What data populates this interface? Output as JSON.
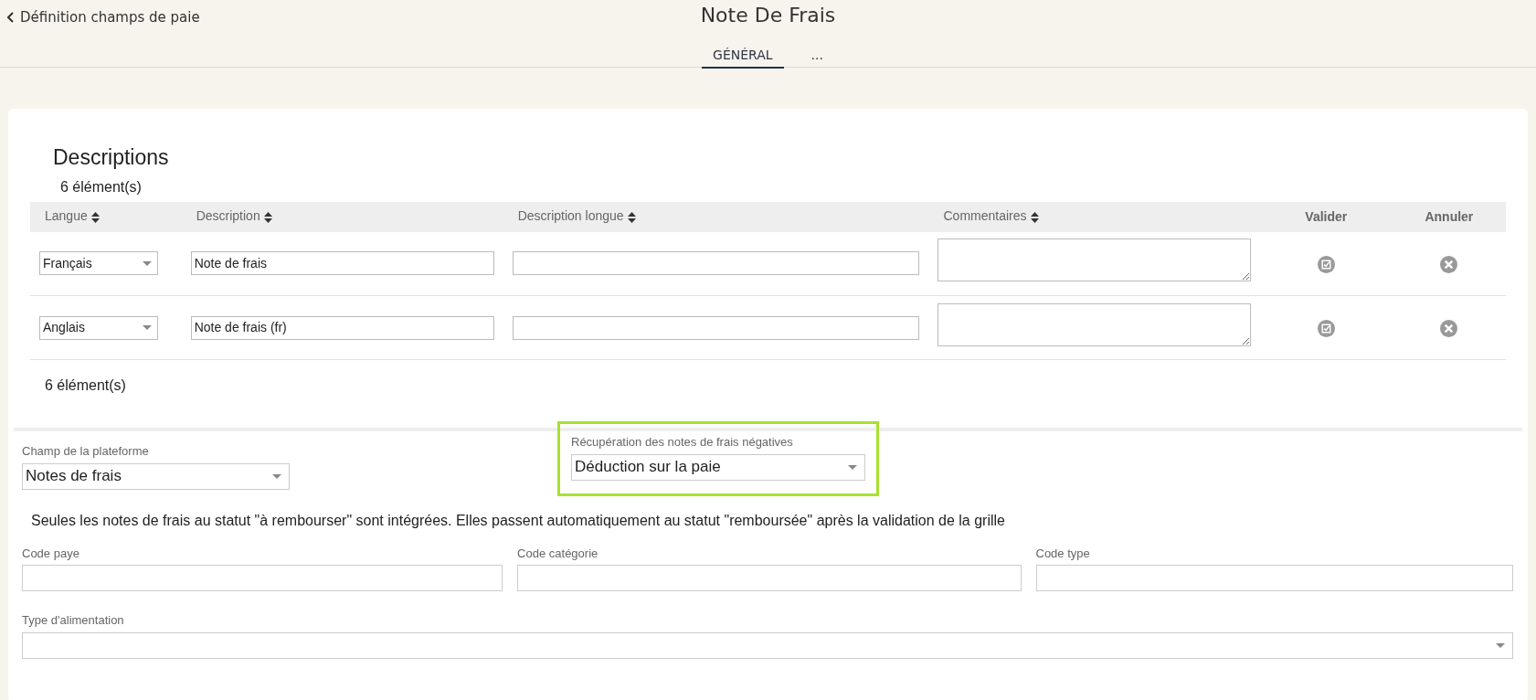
{
  "header": {
    "back_link": "Définition champs de paie",
    "title": "Note De Frais"
  },
  "tabs": [
    {
      "label": "GÉNÉRAL",
      "selected": true
    },
    {
      "label": "...",
      "selected": false
    }
  ],
  "descriptions": {
    "title": "Descriptions",
    "count_top": "6 élément(s)",
    "count_bottom": "6 élément(s)",
    "columns": [
      {
        "label": "Langue",
        "sortable": true
      },
      {
        "label": "Description",
        "sortable": true
      },
      {
        "label": "Description longue",
        "sortable": true
      },
      {
        "label": "Commentaires",
        "sortable": true
      },
      {
        "label": "Valider",
        "sortable": false
      },
      {
        "label": "Annuler",
        "sortable": false
      }
    ],
    "rows": [
      {
        "language": "Français",
        "description": "Note de frais"
      },
      {
        "language": "Anglais",
        "description": "Note de frais (fr)"
      }
    ]
  },
  "settings": [
    {
      "kind": "select",
      "label": "Champ de la plateforme",
      "value": "Notes de frais",
      "highlighted": false
    },
    {
      "kind": "select",
      "label": "Récupération des notes de frais négatives",
      "value": "Déduction sur la paie",
      "highlighted": true
    }
  ],
  "info": "Seules les notes de frais au statut \"à rembourser\" sont intégrées. Elles passent automatiquement au statut \"remboursée\" après la validation de la grille",
  "codes": [
    {
      "kind": "input",
      "label": "Code paye"
    },
    {
      "kind": "input",
      "label": "Code catégorie"
    },
    {
      "kind": "input",
      "label": "Code type"
    }
  ],
  "feed": {
    "kind": "select",
    "label": "Type d'alimentation"
  }
}
